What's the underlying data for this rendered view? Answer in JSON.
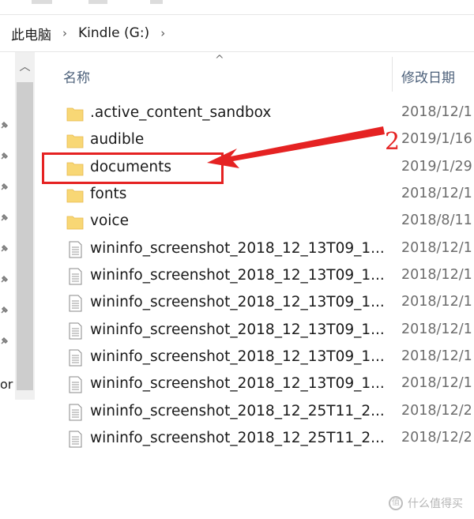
{
  "address_bar": {
    "crumbs": [
      "此电脑",
      "Kindle (G:)"
    ],
    "separator": ">"
  },
  "left_pane": {
    "partial_label": "or"
  },
  "columns": {
    "name": "名称",
    "date": "修改日期",
    "sort_indicator": "^"
  },
  "rows": [
    {
      "name": ".active_content_sandbox",
      "date": "2018/12/1",
      "type": "folder"
    },
    {
      "name": "audible",
      "date": "2019/1/16",
      "type": "folder"
    },
    {
      "name": "documents",
      "date": "2019/1/29",
      "type": "folder"
    },
    {
      "name": "fonts",
      "date": "2018/12/1",
      "type": "folder"
    },
    {
      "name": "voice",
      "date": "2018/8/11",
      "type": "folder"
    },
    {
      "name": "wininfo_screenshot_2018_12_13T09_1...",
      "date": "2018/12/1",
      "type": "file"
    },
    {
      "name": "wininfo_screenshot_2018_12_13T09_1...",
      "date": "2018/12/1",
      "type": "file"
    },
    {
      "name": "wininfo_screenshot_2018_12_13T09_1...",
      "date": "2018/12/1",
      "type": "file"
    },
    {
      "name": "wininfo_screenshot_2018_12_13T09_1...",
      "date": "2018/12/1",
      "type": "file"
    },
    {
      "name": "wininfo_screenshot_2018_12_13T09_1...",
      "date": "2018/12/1",
      "type": "file"
    },
    {
      "name": "wininfo_screenshot_2018_12_13T09_1...",
      "date": "2018/12/1",
      "type": "file"
    },
    {
      "name": "wininfo_screenshot_2018_12_25T11_2...",
      "date": "2018/12/2",
      "type": "file"
    },
    {
      "name": "wininfo_screenshot_2018_12_25T11_2...",
      "date": "2018/12/2",
      "type": "file"
    }
  ],
  "annotation": {
    "number": "2",
    "color": "#e52222"
  },
  "watermark": {
    "text": "什么值得买",
    "icon": "zhi-logo-icon"
  },
  "colors": {
    "folder": "#f8d775",
    "header_text": "#4c607a",
    "date_text": "#6d6d6d"
  }
}
